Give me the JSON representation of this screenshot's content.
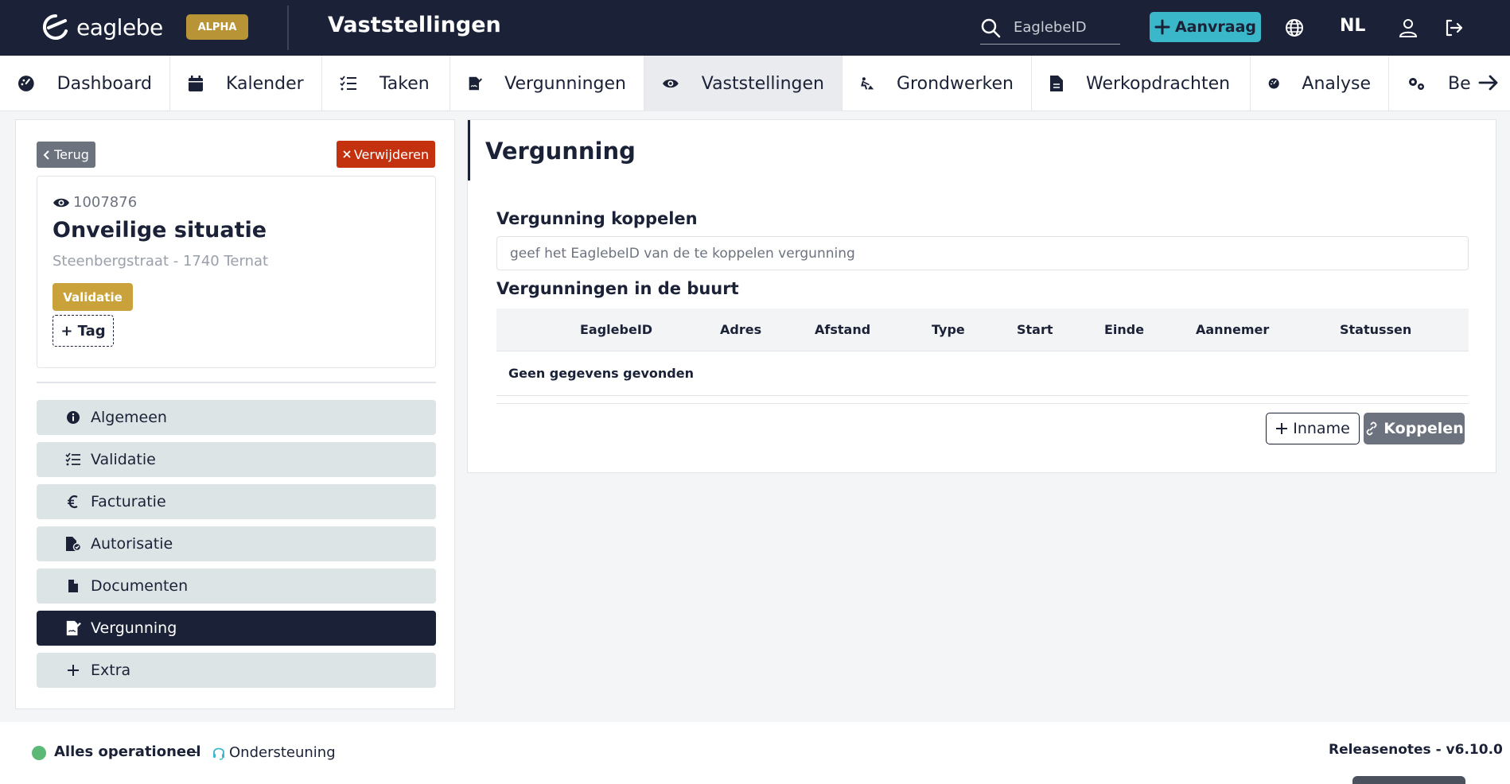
{
  "header": {
    "logo_text": "eaglebe",
    "badge": "ALPHA",
    "page_title": "Vaststellingen",
    "search_placeholder": "EaglebeID",
    "aanvraag_label": "Aanvraag",
    "language": "NL"
  },
  "nav": {
    "tabs": [
      {
        "label": "Dashboard",
        "icon": "dashboard-icon"
      },
      {
        "label": "Kalender",
        "icon": "calendar-icon"
      },
      {
        "label": "Taken",
        "icon": "tasks-icon"
      },
      {
        "label": "Vergunningen",
        "icon": "permit-icon"
      },
      {
        "label": "Vaststellingen",
        "icon": "eye-icon",
        "active": true
      },
      {
        "label": "Grondwerken",
        "icon": "digging-icon"
      },
      {
        "label": "Werkopdrachten",
        "icon": "document-icon"
      },
      {
        "label": "Analyse",
        "icon": "gauge-icon"
      },
      {
        "label": "Be",
        "icon": "settings-icon"
      }
    ]
  },
  "case": {
    "back_label": "Terug",
    "delete_label": "Verwijderen",
    "id": "1007876",
    "title": "Onveilige situatie",
    "address": "Steenbergstraat - 1740 Ternat",
    "status": "Validatie",
    "tag_label": "+ Tag"
  },
  "menu": {
    "items": [
      {
        "label": "Algemeen",
        "icon": "info-icon"
      },
      {
        "label": "Validatie",
        "icon": "checklist-icon"
      },
      {
        "label": "Facturatie",
        "icon": "euro-icon"
      },
      {
        "label": "Autorisatie",
        "icon": "file-check-icon"
      },
      {
        "label": "Documenten",
        "icon": "file-icon"
      },
      {
        "label": "Vergunning",
        "icon": "permit-icon",
        "active": true
      },
      {
        "label": "Extra",
        "icon": "plus-icon"
      }
    ]
  },
  "permit": {
    "section_title": "Vergunning",
    "link_label": "Vergunning koppelen",
    "link_placeholder": "geef het EaglebeID van de te koppelen vergunning",
    "nearby_label": "Vergunningen in de buurt",
    "columns": [
      "EaglebeID",
      "Adres",
      "Afstand",
      "Type",
      "Start",
      "Einde",
      "Aannemer",
      "Statussen"
    ],
    "empty_text": "Geen gegevens gevonden",
    "inname_label": "Inname",
    "koppelen_label": "Koppelen"
  },
  "footer": {
    "status": "Alles operationeel",
    "separator": "-",
    "support": "Ondersteuning",
    "release": "Releasenotes - v6.10.0"
  },
  "colors": {
    "navy": "#1b2237",
    "accent": "#3ab7c8",
    "badge": "#b89436",
    "danger": "#c4310f",
    "status_ok": "#5cb877",
    "validatie": "#c9a23c"
  }
}
